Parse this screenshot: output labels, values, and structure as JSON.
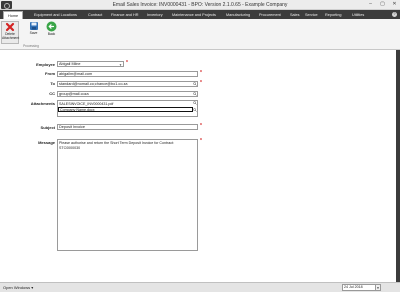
{
  "window": {
    "title": "Email Sales Invoice: INV0000431 - BPO: Version 2.1.0.65 - Example Company",
    "controls": [
      "–",
      "▢",
      "✕"
    ]
  },
  "ribbon": {
    "tabs": [
      "Home",
      "Equipment and Locations",
      "Contract",
      "Finance and HR",
      "Inventory",
      "Maintenance and Projects",
      "Manufacturing",
      "Procurement",
      "Sales",
      "Service",
      "Reporting",
      "Utilities"
    ],
    "active_tab": "Home",
    "help": "?",
    "buttons": {
      "delete_attachment": "Delete Attachment",
      "save": "Save",
      "back": "Back"
    },
    "group_label": "Processing"
  },
  "form": {
    "employee": {
      "label": "Employee",
      "value": "Abigail Milne"
    },
    "from": {
      "label": "From",
      "value": "abigailm@mail.com"
    },
    "to": {
      "label": "To",
      "value": "standard@nomail.co;chance@bo1.co.za"
    },
    "cc": {
      "label": "CC",
      "value": "group@mail.coza"
    },
    "attachments": {
      "label": "Attachments",
      "items": [
        "SALESINVOICE_INV0000431.pdf",
        "Company Name.docx"
      ]
    },
    "subject": {
      "label": "Subject",
      "value": "Deposit Invoice"
    },
    "message": {
      "label": "Message",
      "value": "Please authorise and return the Short Term Deposit Invoice for Contract: STC0000030"
    }
  },
  "statusbar": {
    "open_windows": "Open Windows ▾",
    "date": "24 Jul 2018"
  },
  "colors": {
    "dark_chrome": "#3c3c3c",
    "required_marker": "#d32323",
    "delete_icon": "#d32323",
    "save_icon": "#2f6fb5",
    "back_icon": "#3aa548"
  }
}
